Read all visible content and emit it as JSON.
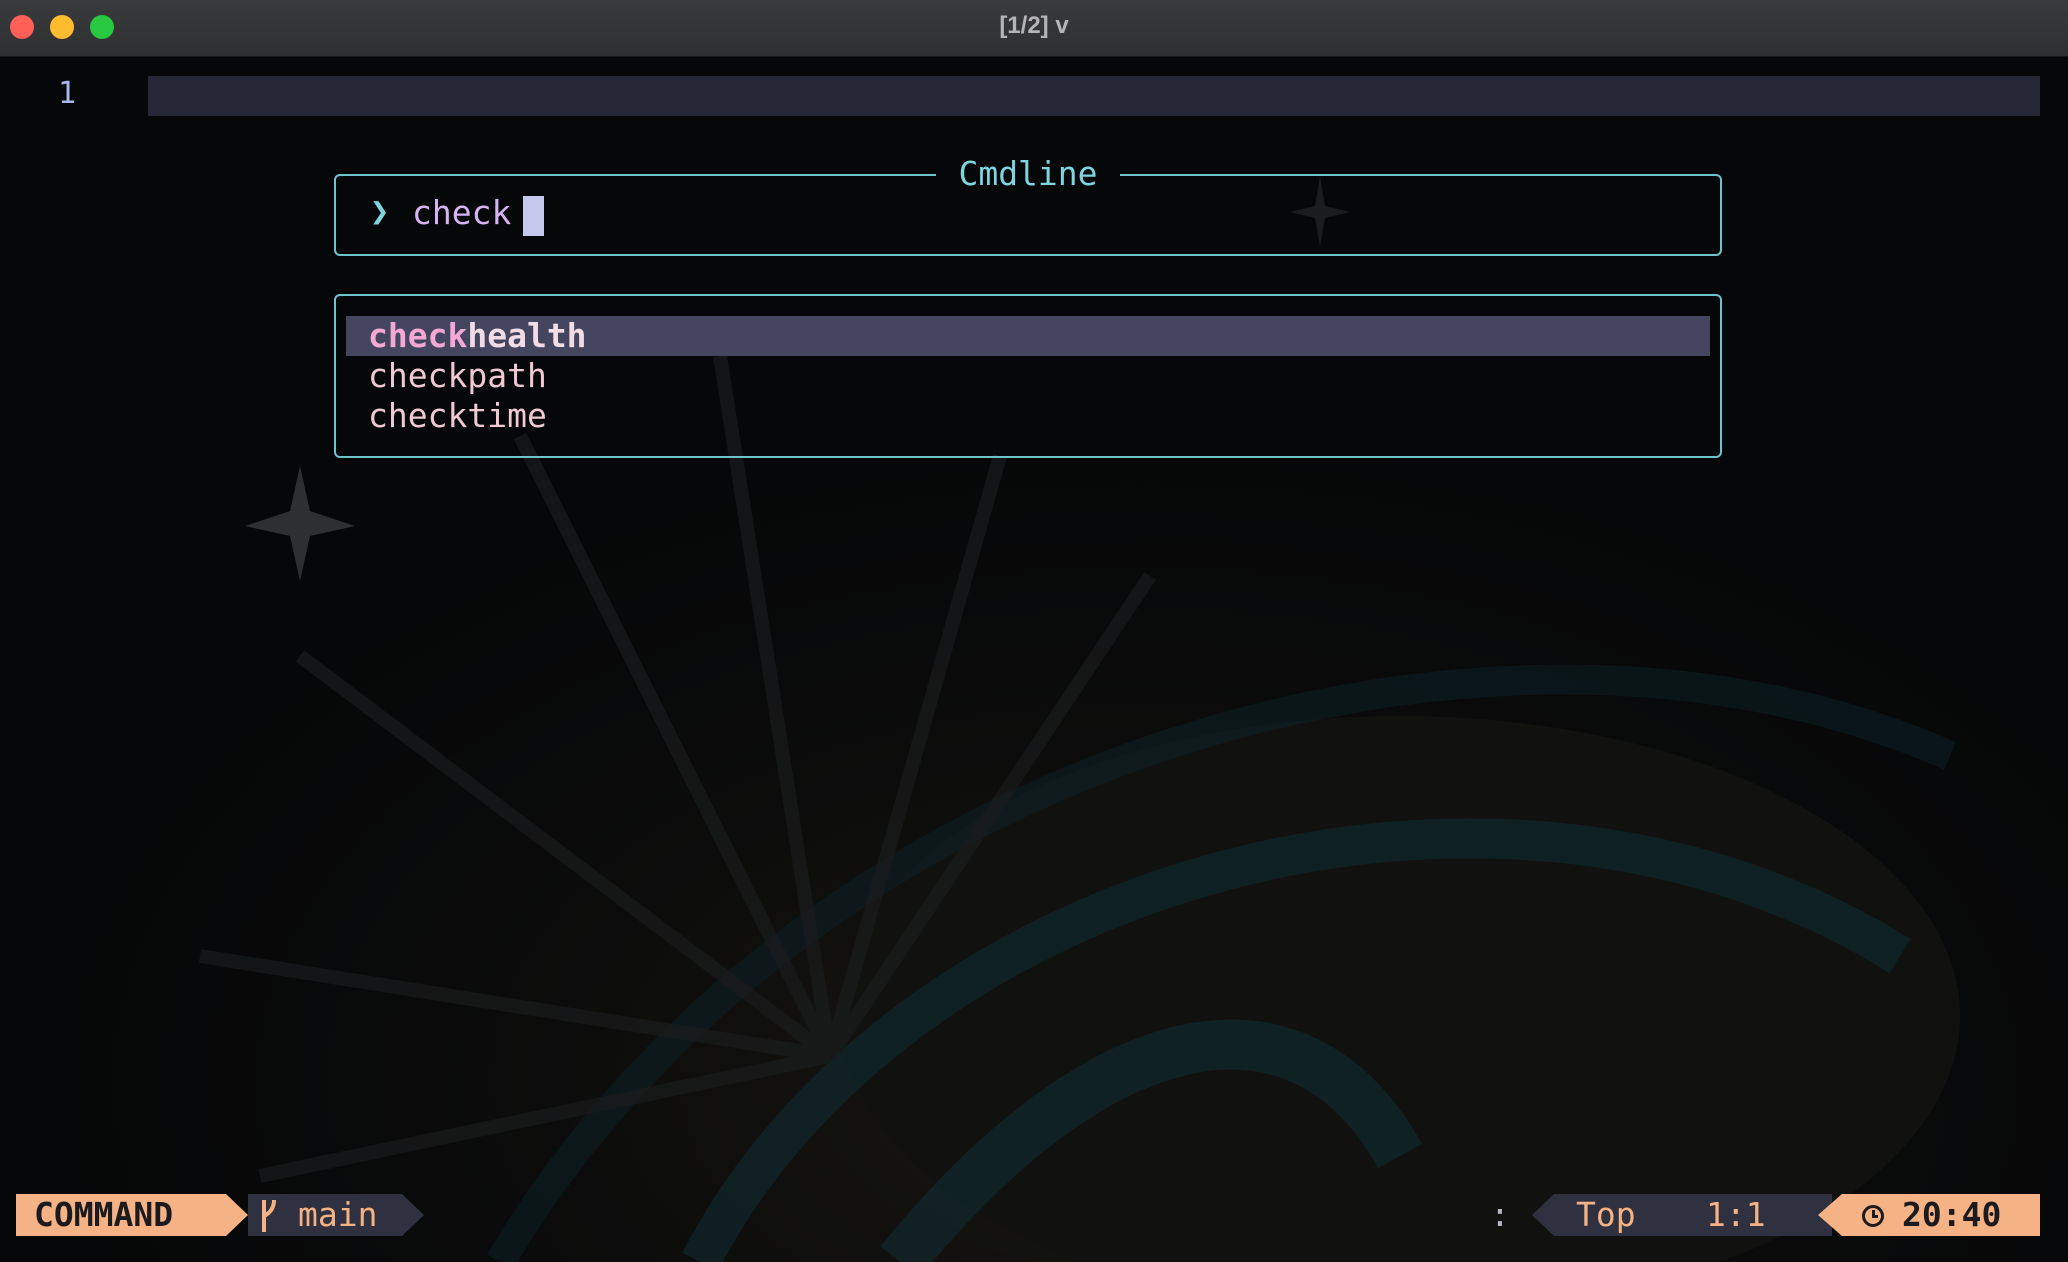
{
  "window": {
    "title": "[1/2] v"
  },
  "editor": {
    "line_numbers": [
      "1"
    ]
  },
  "cmdline": {
    "title": "Cmdline",
    "prompt_icon": "chevron-right-icon",
    "value": "check"
  },
  "completion": {
    "typed_match": "check",
    "items": [
      {
        "match": "check",
        "rest": "health",
        "full": "checkhealth",
        "selected": true
      },
      {
        "match": "check",
        "rest": "path",
        "full": "checkpath",
        "selected": false
      },
      {
        "match": "check",
        "rest": "time",
        "full": "checktime",
        "selected": false
      }
    ]
  },
  "statusline": {
    "mode": "COMMAND",
    "branch_icon": "git-branch-icon",
    "branch": "main",
    "cmd_indicator": ":",
    "position": "Top",
    "row_col": "1:1",
    "clock_icon": "clock-icon",
    "time": "20:40"
  },
  "colors": {
    "accent_peach": "#f5b284",
    "border_cyan": "#6fc3cf",
    "match_pink": "#f6a8d4",
    "text_lavender": "#d6b3f3"
  }
}
